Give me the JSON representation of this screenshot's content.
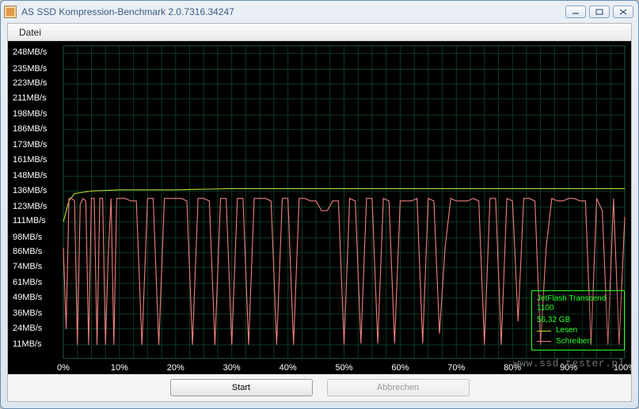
{
  "window": {
    "title": "AS SSD Kompression-Benchmark 2.0.7316.34247"
  },
  "menubar": {
    "file_label": "Datei"
  },
  "buttons": {
    "start_label": "Start",
    "cancel_label": "Abbrechen"
  },
  "legend": {
    "device": "JetFlash Transcend 1100",
    "capacity": "56,32 GB",
    "read_label": "Lesen",
    "write_label": "Schreiben",
    "read_color": "#b7e030",
    "write_color": "#f08080"
  },
  "watermark": "www.ssd-tester.pl",
  "chart_data": {
    "type": "line",
    "title": "",
    "xlabel": "",
    "ylabel": "MB/s",
    "x_ticks_percent": [
      0,
      10,
      20,
      30,
      40,
      50,
      60,
      70,
      80,
      90,
      100
    ],
    "y_ticks_mb_s": [
      11,
      24,
      36,
      49,
      61,
      74,
      86,
      98,
      111,
      123,
      136,
      148,
      161,
      173,
      186,
      198,
      211,
      223,
      235,
      248
    ],
    "y_tick_suffix": "MB/s",
    "xlim": [
      0,
      100
    ],
    "ylim": [
      0,
      254
    ],
    "series": [
      {
        "name": "Lesen",
        "color": "#b7e030",
        "x": [
          0,
          1,
          2,
          5,
          10,
          20,
          30,
          40,
          50,
          60,
          70,
          80,
          90,
          100
        ],
        "y": [
          111,
          128,
          134,
          136,
          137,
          137,
          138,
          138,
          138,
          138,
          138,
          138,
          138,
          138
        ]
      },
      {
        "name": "Schreiben",
        "color": "#f08080",
        "x": [
          0,
          0.5,
          1,
          1.5,
          2,
          2.5,
          3,
          3.5,
          4,
          4.5,
          5,
          5.5,
          6,
          6.5,
          7,
          7.5,
          8,
          8.5,
          9,
          9.5,
          10,
          11,
          12,
          13,
          14,
          15,
          16,
          17,
          18,
          19,
          20,
          21,
          22,
          23,
          24,
          25,
          26,
          27,
          28,
          29,
          30,
          31,
          32,
          33,
          34,
          35,
          36,
          37,
          38,
          39,
          40,
          41,
          42,
          43,
          44,
          45,
          46,
          47,
          48,
          49,
          50,
          51,
          52,
          53,
          54,
          55,
          56,
          57,
          58,
          59,
          60,
          61,
          62,
          63,
          64,
          65,
          66,
          67,
          68,
          69,
          70,
          71,
          72,
          73,
          74,
          75,
          76,
          77,
          78,
          79,
          80,
          81,
          82,
          83,
          84,
          85,
          86,
          87,
          88,
          89,
          90,
          91,
          92,
          93,
          94,
          95,
          96,
          97,
          98,
          99,
          100
        ],
        "y": [
          90,
          24,
          130,
          130,
          128,
          11,
          125,
          130,
          128,
          11,
          130,
          130,
          11,
          130,
          130,
          11,
          85,
          130,
          11,
          130,
          130,
          130,
          128,
          128,
          11,
          130,
          130,
          11,
          130,
          130,
          130,
          130,
          128,
          11,
          130,
          130,
          128,
          11,
          130,
          130,
          11,
          130,
          130,
          11,
          130,
          130,
          130,
          128,
          11,
          130,
          130,
          11,
          130,
          130,
          128,
          128,
          120,
          120,
          128,
          128,
          11,
          130,
          128,
          12,
          130,
          130,
          12,
          130,
          128,
          12,
          128,
          128,
          128,
          130,
          12,
          130,
          128,
          20,
          90,
          130,
          128,
          128,
          128,
          130,
          128,
          11,
          130,
          130,
          11,
          130,
          128,
          30,
          130,
          130,
          128,
          11,
          90,
          130,
          128,
          128,
          130,
          130,
          128,
          128,
          11,
          130,
          120,
          11,
          130,
          11,
          115
        ]
      }
    ]
  }
}
